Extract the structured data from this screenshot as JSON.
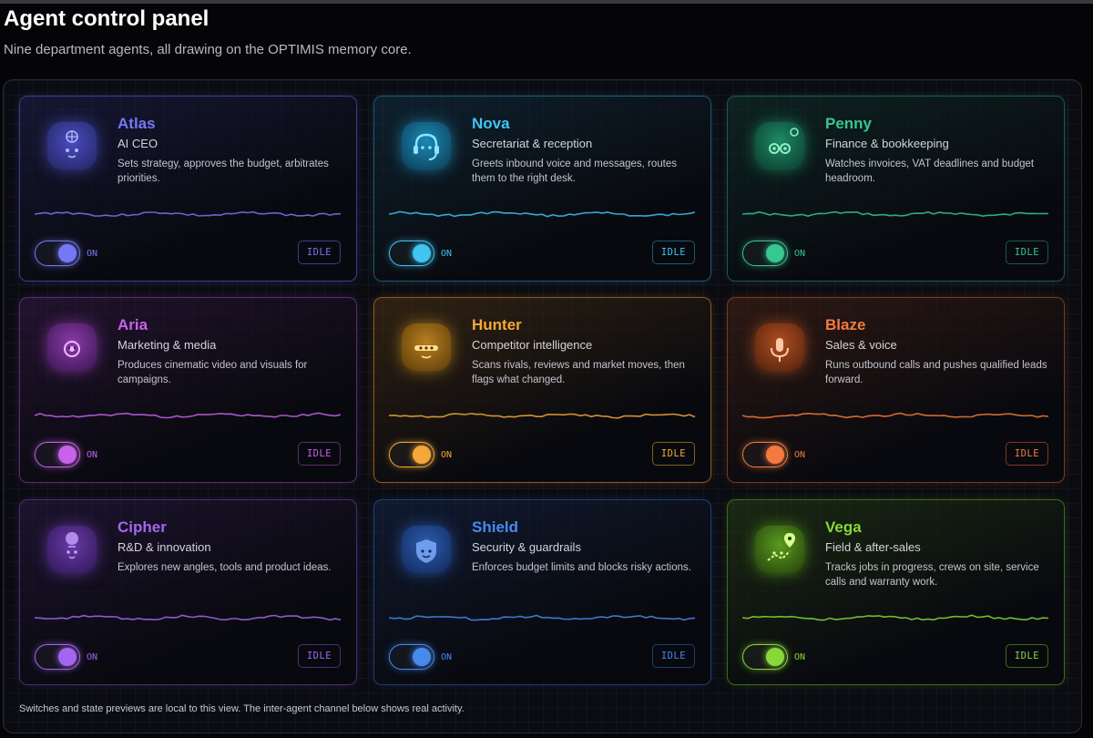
{
  "header": {
    "title": "Agent control panel",
    "subtitle": "Nine department agents, all drawing on the OPTIMIS memory core."
  },
  "agents": [
    {
      "name": "Atlas",
      "role": "AI CEO",
      "description": "Sets strategy, approves the budget, arbitrates priorities.",
      "toggle_label": "ON",
      "toggle_on": true,
      "state": "IDLE",
      "accent": "#6a6cf0",
      "icon": "globe-face-icon"
    },
    {
      "name": "Nova",
      "role": "Secretariat & reception",
      "description": "Greets inbound voice and messages, routes them to the right desk.",
      "toggle_label": "ON",
      "toggle_on": true,
      "state": "IDLE",
      "accent": "#38b8e6",
      "icon": "headset-icon"
    },
    {
      "name": "Penny",
      "role": "Finance & bookkeeping",
      "description": "Watches invoices, VAT deadlines and budget headroom.",
      "toggle_label": "ON",
      "toggle_on": true,
      "state": "IDLE",
      "accent": "#2ec08a",
      "icon": "coins-icon"
    },
    {
      "name": "Aria",
      "role": "Marketing & media",
      "description": "Produces cinematic video and visuals for campaigns.",
      "toggle_label": "ON",
      "toggle_on": true,
      "state": "IDLE",
      "accent": "#c05ae0",
      "icon": "camera-icon"
    },
    {
      "name": "Hunter",
      "role": "Competitor intelligence",
      "description": "Scans rivals, reviews and market moves, then flags what changed.",
      "toggle_label": "ON",
      "toggle_on": true,
      "state": "IDLE",
      "accent": "#f0a030",
      "icon": "visor-icon"
    },
    {
      "name": "Blaze",
      "role": "Sales & voice",
      "description": "Runs outbound calls and pushes qualified leads forward.",
      "toggle_label": "ON",
      "toggle_on": true,
      "state": "IDLE",
      "accent": "#f07038",
      "icon": "microphone-icon"
    },
    {
      "name": "Cipher",
      "role": "R&D & innovation",
      "description": "Explores new angles, tools and product ideas.",
      "toggle_label": "ON",
      "toggle_on": true,
      "state": "IDLE",
      "accent": "#9a5ae8",
      "icon": "lightbulb-icon"
    },
    {
      "name": "Shield",
      "role": "Security & guardrails",
      "description": "Enforces budget limits and blocks risky actions.",
      "toggle_label": "ON",
      "toggle_on": true,
      "state": "IDLE",
      "accent": "#3a80ea",
      "icon": "shield-icon"
    },
    {
      "name": "Vega",
      "role": "Field & after-sales",
      "description": "Tracks jobs in progress, crews on site, service calls and warranty work.",
      "toggle_label": "ON",
      "toggle_on": true,
      "state": "IDLE",
      "accent": "#80d030",
      "icon": "map-pin-icon"
    }
  ],
  "footer": {
    "note": "Switches and state previews are local to this view. The inter-agent channel below shows real activity."
  }
}
